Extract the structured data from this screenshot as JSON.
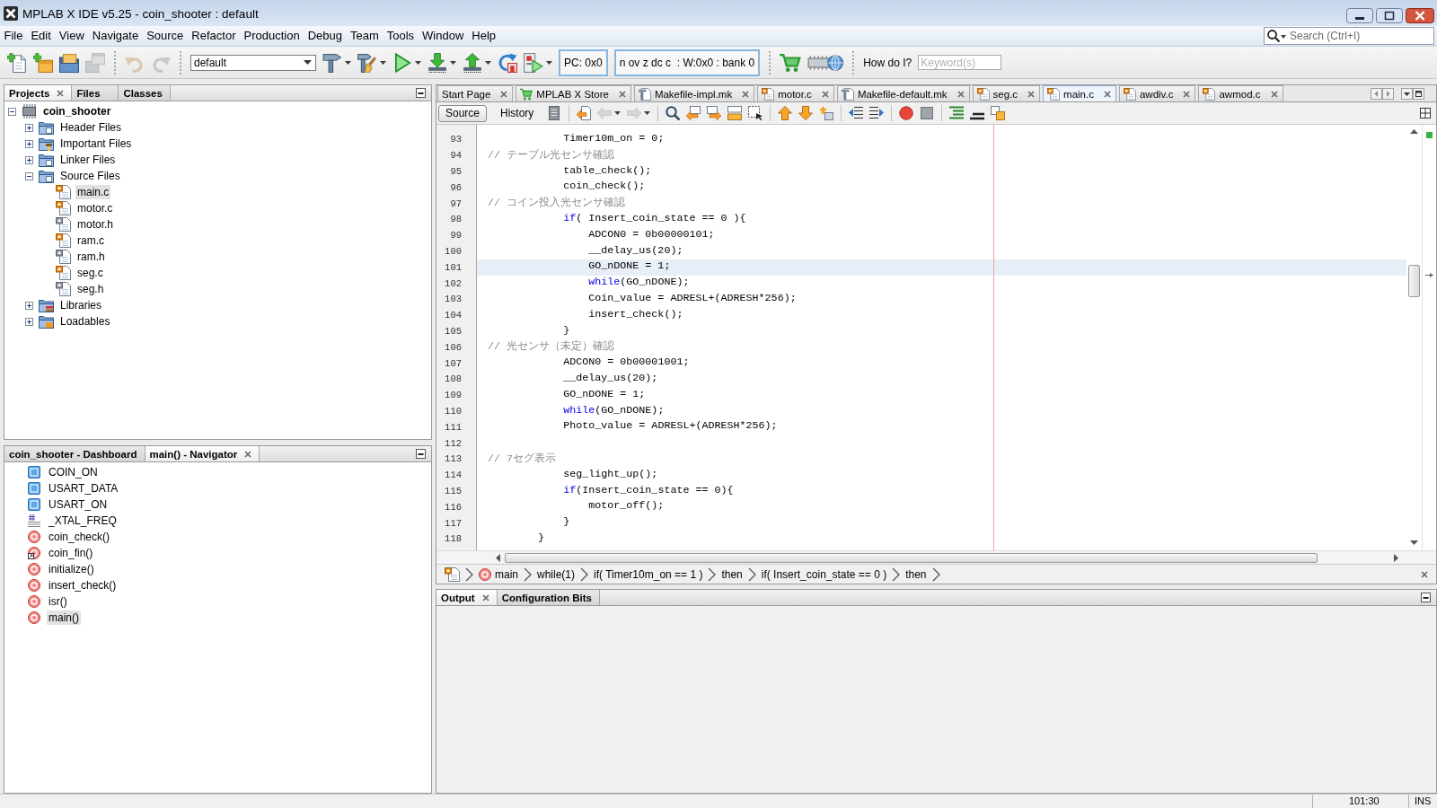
{
  "window": {
    "title": "MPLAB X IDE v5.25 - coin_shooter : default"
  },
  "menu": [
    "File",
    "Edit",
    "View",
    "Navigate",
    "Source",
    "Refactor",
    "Production",
    "Debug",
    "Team",
    "Tools",
    "Window",
    "Help"
  ],
  "search": {
    "placeholder": "Search (Ctrl+I)"
  },
  "toolbar": {
    "groups": [
      [
        {
          "kind": "newfile",
          "disabled": false,
          "menu": false
        },
        {
          "kind": "newproject",
          "disabled": false,
          "menu": false
        },
        {
          "kind": "openproject",
          "disabled": false,
          "menu": false
        },
        {
          "kind": "closeproject",
          "disabled": true,
          "menu": false
        }
      ],
      [
        {
          "kind": "undo",
          "disabled": true,
          "menu": false
        },
        {
          "kind": "redo",
          "disabled": true,
          "menu": false
        }
      ],
      [
        {
          "kind": "select",
          "value": "default",
          "disabled": false,
          "menu": false
        },
        {
          "kind": "build",
          "disabled": false,
          "menu": true
        },
        {
          "kind": "cleanbuild",
          "disabled": false,
          "menu": true
        },
        {
          "kind": "run",
          "disabled": false,
          "menu": true
        },
        {
          "kind": "program",
          "disabled": false,
          "menu": true
        },
        {
          "kind": "read",
          "disabled": false,
          "menu": true
        },
        {
          "kind": "reset",
          "disabled": false,
          "menu": false
        },
        {
          "kind": "debugrun",
          "disabled": false,
          "menu": true
        },
        {
          "kind": "readout",
          "text": "PC: 0x0",
          "disabled": false,
          "menu": false
        },
        {
          "kind": "readout",
          "text": "n ov z dc c  : W:0x0 : bank 0",
          "disabled": false,
          "menu": false
        }
      ],
      [
        {
          "kind": "store",
          "disabled": false,
          "menu": false
        },
        {
          "kind": "chipweb",
          "disabled": false,
          "menu": false
        }
      ],
      [
        {
          "kind": "label",
          "text": "How do I?",
          "disabled": false,
          "menu": false
        },
        {
          "kind": "field",
          "placeholder": "Keyword(s)",
          "disabled": false,
          "menu": false
        }
      ]
    ]
  },
  "projects_panel": {
    "tabs": [
      {
        "label": "Projects",
        "selected": true
      },
      {
        "label": "Files",
        "selected": false
      },
      {
        "label": "Classes",
        "selected": false
      }
    ],
    "tree": [
      {
        "label": "coin_shooter",
        "kind": "project",
        "expanded": true,
        "selected": false,
        "children": [
          {
            "label": "Header Files",
            "kind": "docfolder",
            "expanded": false,
            "selected": false
          },
          {
            "label": "Important Files",
            "kind": "toolfolder",
            "expanded": false,
            "selected": false
          },
          {
            "label": "Linker Files",
            "kind": "docfolder",
            "expanded": false,
            "selected": false
          },
          {
            "label": "Source Files",
            "kind": "docfolder",
            "expanded": true,
            "selected": false,
            "children": [
              {
                "label": "main.c",
                "kind": "cfile",
                "selected": true
              },
              {
                "label": "motor.c",
                "kind": "cfile",
                "selected": false
              },
              {
                "label": "motor.h",
                "kind": "hfile",
                "selected": false
              },
              {
                "label": "ram.c",
                "kind": "cfile",
                "selected": false
              },
              {
                "label": "ram.h",
                "kind": "hfile",
                "selected": false
              },
              {
                "label": "seg.c",
                "kind": "cfile",
                "selected": false
              },
              {
                "label": "seg.h",
                "kind": "hfile",
                "selected": false
              }
            ]
          },
          {
            "label": "Libraries",
            "kind": "libfolder",
            "expanded": false,
            "selected": false
          },
          {
            "label": "Loadables",
            "kind": "binfolder",
            "expanded": false,
            "selected": false
          }
        ]
      }
    ]
  },
  "navigator_panel": {
    "tabs": [
      {
        "label": "coin_shooter - Dashboard",
        "selected": false
      },
      {
        "label": "main() - Navigator",
        "selected": true
      }
    ],
    "items": [
      {
        "label": "COIN_ON",
        "kind": "variable",
        "selected": false
      },
      {
        "label": "USART_DATA",
        "kind": "variable",
        "selected": false
      },
      {
        "label": "USART_ON",
        "kind": "variable",
        "selected": false
      },
      {
        "label": "_XTAL_FREQ",
        "kind": "macro",
        "selected": false
      },
      {
        "label": "coin_check()",
        "kind": "function",
        "selected": false
      },
      {
        "label": "coin_fin()",
        "kind": "prototype",
        "selected": false
      },
      {
        "label": "initialize()",
        "kind": "function",
        "selected": false
      },
      {
        "label": "insert_check()",
        "kind": "function",
        "selected": false
      },
      {
        "label": "isr()",
        "kind": "function",
        "selected": false
      },
      {
        "label": "main()",
        "kind": "function",
        "selected": true
      }
    ]
  },
  "editor": {
    "tabs": [
      {
        "label": "Start Page",
        "kind": "page",
        "selected": false
      },
      {
        "label": "MPLAB X Store",
        "kind": "store",
        "selected": false
      },
      {
        "label": "Makefile-impl.mk",
        "kind": "makefile",
        "selected": false
      },
      {
        "label": "motor.c",
        "kind": "csource",
        "selected": false
      },
      {
        "label": "Makefile-default.mk",
        "kind": "makefile",
        "selected": false
      },
      {
        "label": "seg.c",
        "kind": "csource",
        "selected": false
      },
      {
        "label": "main.c",
        "kind": "csource",
        "selected": true
      },
      {
        "label": "awdiv.c",
        "kind": "csource",
        "selected": false
      },
      {
        "label": "awmod.c",
        "kind": "csource",
        "selected": false
      }
    ],
    "views": [
      {
        "label": "Source",
        "selected": true
      },
      {
        "label": "History",
        "selected": false
      }
    ],
    "tools": [
      [
        {
          "kind": "document",
          "disabled": false,
          "menu": false
        }
      ],
      [
        {
          "kind": "lastedit",
          "disabled": false,
          "menu": false
        },
        {
          "kind": "back",
          "disabled": true,
          "menu": true
        },
        {
          "kind": "forward",
          "disabled": true,
          "menu": true
        }
      ],
      [
        {
          "kind": "search",
          "disabled": false,
          "menu": false
        },
        {
          "kind": "findprev",
          "disabled": false,
          "menu": false
        },
        {
          "kind": "findnext",
          "disabled": false,
          "menu": false
        },
        {
          "kind": "highlight",
          "disabled": false,
          "menu": false
        },
        {
          "kind": "selection",
          "disabled": false,
          "menu": false
        }
      ],
      [
        {
          "kind": "prevmark",
          "disabled": false,
          "menu": false
        },
        {
          "kind": "nextmark",
          "disabled": false,
          "menu": false
        },
        {
          "kind": "togglemark",
          "disabled": false,
          "menu": false
        }
      ],
      [
        {
          "kind": "shiftleft",
          "disabled": false,
          "menu": false
        },
        {
          "kind": "shiftright",
          "disabled": false,
          "menu": false
        }
      ],
      [
        {
          "kind": "record",
          "disabled": false,
          "menu": false
        },
        {
          "kind": "stop",
          "disabled": false,
          "menu": false
        }
      ],
      [
        {
          "kind": "comment",
          "disabled": false,
          "menu": false
        },
        {
          "kind": "uncomment",
          "disabled": false,
          "menu": false
        },
        {
          "kind": "diff",
          "disabled": false,
          "menu": false
        }
      ]
    ],
    "lines": [
      {
        "number": "93",
        "current": false,
        "tokens": [
          {
            "kind": "plain",
            "text": "            Timer10m_on = 0;"
          }
        ]
      },
      {
        "number": "94",
        "current": false,
        "tokens": [
          {
            "kind": "comment",
            "text": "// テーブル光センサ確認"
          }
        ]
      },
      {
        "number": "95",
        "current": false,
        "tokens": [
          {
            "kind": "plain",
            "text": "            table_check();"
          }
        ]
      },
      {
        "number": "96",
        "current": false,
        "tokens": [
          {
            "kind": "plain",
            "text": "            coin_check();"
          }
        ]
      },
      {
        "number": "97",
        "current": false,
        "tokens": [
          {
            "kind": "comment",
            "text": "// コイン投入光センサ確認"
          }
        ]
      },
      {
        "number": "98",
        "current": false,
        "tokens": [
          {
            "kind": "keyword",
            "text": "            if"
          },
          {
            "kind": "plain",
            "text": "( Insert_coin_state == 0 ){"
          }
        ]
      },
      {
        "number": "99",
        "current": false,
        "tokens": [
          {
            "kind": "plain",
            "text": "                ADCON0 = 0b00000101;"
          }
        ]
      },
      {
        "number": "100",
        "current": false,
        "tokens": [
          {
            "kind": "plain",
            "text": "                __delay_us(20);"
          }
        ]
      },
      {
        "number": "101",
        "current": true,
        "tokens": [
          {
            "kind": "plain",
            "text": "                GO_nDONE = 1;"
          }
        ]
      },
      {
        "number": "102",
        "current": false,
        "tokens": [
          {
            "kind": "keyword",
            "text": "                while"
          },
          {
            "kind": "plain",
            "text": "(GO_nDONE);"
          }
        ]
      },
      {
        "number": "103",
        "current": false,
        "tokens": [
          {
            "kind": "plain",
            "text": "                Coin_value = ADRESL+(ADRESH*256);"
          }
        ]
      },
      {
        "number": "104",
        "current": false,
        "tokens": [
          {
            "kind": "plain",
            "text": "                insert_check();"
          }
        ]
      },
      {
        "number": "105",
        "current": false,
        "tokens": [
          {
            "kind": "plain",
            "text": "            }"
          }
        ]
      },
      {
        "number": "106",
        "current": false,
        "tokens": [
          {
            "kind": "comment",
            "text": "// 光センサ（未定）確認"
          }
        ]
      },
      {
        "number": "107",
        "current": false,
        "tokens": [
          {
            "kind": "plain",
            "text": "            ADCON0 = 0b00001001;"
          }
        ]
      },
      {
        "number": "108",
        "current": false,
        "tokens": [
          {
            "kind": "plain",
            "text": "            __delay_us(20);"
          }
        ]
      },
      {
        "number": "109",
        "current": false,
        "tokens": [
          {
            "kind": "plain",
            "text": "            GO_nDONE = 1;"
          }
        ]
      },
      {
        "number": "110",
        "current": false,
        "tokens": [
          {
            "kind": "keyword",
            "text": "            while"
          },
          {
            "kind": "plain",
            "text": "(GO_nDONE);"
          }
        ]
      },
      {
        "number": "111",
        "current": false,
        "tokens": [
          {
            "kind": "plain",
            "text": "            Photo_value = ADRESL+(ADRESH*256);"
          }
        ]
      },
      {
        "number": "112",
        "current": false
      },
      {
        "number": "113",
        "current": false,
        "tokens": [
          {
            "kind": "comment",
            "text": "// 7セグ表示"
          }
        ]
      },
      {
        "number": "114",
        "current": false,
        "tokens": [
          {
            "kind": "plain",
            "text": "            seg_light_up();"
          }
        ]
      },
      {
        "number": "115",
        "current": false,
        "tokens": [
          {
            "kind": "keyword",
            "text": "            if"
          },
          {
            "kind": "plain",
            "text": "(Insert_coin_state == 0){"
          }
        ]
      },
      {
        "number": "116",
        "current": false,
        "tokens": [
          {
            "kind": "plain",
            "text": "                motor_off();"
          }
        ]
      },
      {
        "number": "117",
        "current": false,
        "tokens": [
          {
            "kind": "plain",
            "text": "            }"
          }
        ]
      },
      {
        "number": "118",
        "current": false,
        "tokens": [
          {
            "kind": "plain",
            "text": "        }"
          }
        ]
      }
    ],
    "breadcrumb": [
      {
        "kind": "file"
      },
      {
        "kind": "function",
        "label": "main"
      },
      {
        "kind": "block",
        "label": "while(1)"
      },
      {
        "kind": "block",
        "label": "if( Timer10m_on == 1 )"
      },
      {
        "kind": "block",
        "label": "then"
      },
      {
        "kind": "block",
        "label": "if( Insert_coin_state == 0 )"
      },
      {
        "kind": "block",
        "label": "then"
      }
    ]
  },
  "output_panel": {
    "tabs": [
      {
        "label": "Output",
        "selected": true
      },
      {
        "label": "Configuration Bits",
        "selected": false
      }
    ]
  },
  "status_bar": {
    "position": "101:30",
    "mode": "INS"
  }
}
